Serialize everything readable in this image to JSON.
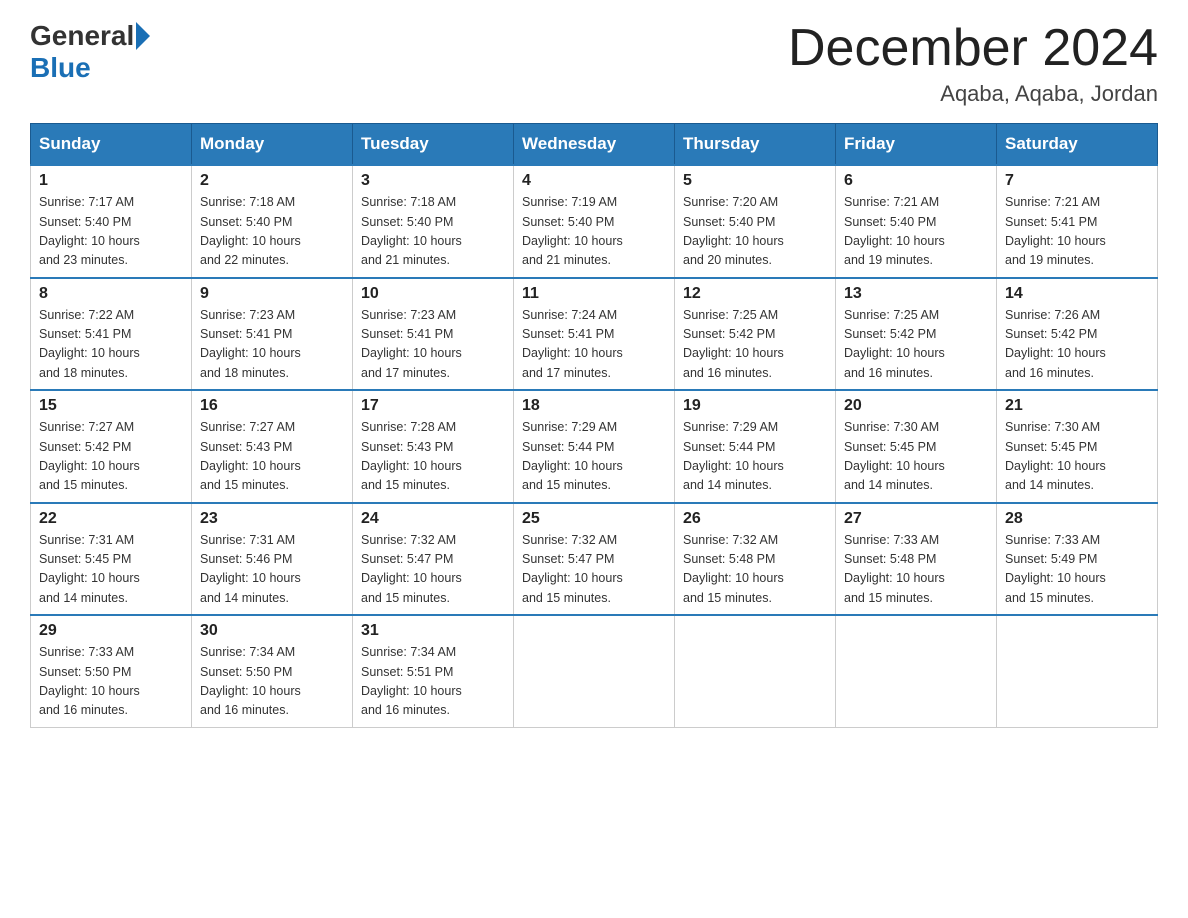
{
  "logo": {
    "general": "General",
    "blue": "Blue"
  },
  "title": "December 2024",
  "location": "Aqaba, Aqaba, Jordan",
  "days_of_week": [
    "Sunday",
    "Monday",
    "Tuesday",
    "Wednesday",
    "Thursday",
    "Friday",
    "Saturday"
  ],
  "weeks": [
    [
      {
        "day": "1",
        "sunrise": "7:17 AM",
        "sunset": "5:40 PM",
        "daylight": "10 hours and 23 minutes."
      },
      {
        "day": "2",
        "sunrise": "7:18 AM",
        "sunset": "5:40 PM",
        "daylight": "10 hours and 22 minutes."
      },
      {
        "day": "3",
        "sunrise": "7:18 AM",
        "sunset": "5:40 PM",
        "daylight": "10 hours and 21 minutes."
      },
      {
        "day": "4",
        "sunrise": "7:19 AM",
        "sunset": "5:40 PM",
        "daylight": "10 hours and 21 minutes."
      },
      {
        "day": "5",
        "sunrise": "7:20 AM",
        "sunset": "5:40 PM",
        "daylight": "10 hours and 20 minutes."
      },
      {
        "day": "6",
        "sunrise": "7:21 AM",
        "sunset": "5:40 PM",
        "daylight": "10 hours and 19 minutes."
      },
      {
        "day": "7",
        "sunrise": "7:21 AM",
        "sunset": "5:41 PM",
        "daylight": "10 hours and 19 minutes."
      }
    ],
    [
      {
        "day": "8",
        "sunrise": "7:22 AM",
        "sunset": "5:41 PM",
        "daylight": "10 hours and 18 minutes."
      },
      {
        "day": "9",
        "sunrise": "7:23 AM",
        "sunset": "5:41 PM",
        "daylight": "10 hours and 18 minutes."
      },
      {
        "day": "10",
        "sunrise": "7:23 AM",
        "sunset": "5:41 PM",
        "daylight": "10 hours and 17 minutes."
      },
      {
        "day": "11",
        "sunrise": "7:24 AM",
        "sunset": "5:41 PM",
        "daylight": "10 hours and 17 minutes."
      },
      {
        "day": "12",
        "sunrise": "7:25 AM",
        "sunset": "5:42 PM",
        "daylight": "10 hours and 16 minutes."
      },
      {
        "day": "13",
        "sunrise": "7:25 AM",
        "sunset": "5:42 PM",
        "daylight": "10 hours and 16 minutes."
      },
      {
        "day": "14",
        "sunrise": "7:26 AM",
        "sunset": "5:42 PM",
        "daylight": "10 hours and 16 minutes."
      }
    ],
    [
      {
        "day": "15",
        "sunrise": "7:27 AM",
        "sunset": "5:42 PM",
        "daylight": "10 hours and 15 minutes."
      },
      {
        "day": "16",
        "sunrise": "7:27 AM",
        "sunset": "5:43 PM",
        "daylight": "10 hours and 15 minutes."
      },
      {
        "day": "17",
        "sunrise": "7:28 AM",
        "sunset": "5:43 PM",
        "daylight": "10 hours and 15 minutes."
      },
      {
        "day": "18",
        "sunrise": "7:29 AM",
        "sunset": "5:44 PM",
        "daylight": "10 hours and 15 minutes."
      },
      {
        "day": "19",
        "sunrise": "7:29 AM",
        "sunset": "5:44 PM",
        "daylight": "10 hours and 14 minutes."
      },
      {
        "day": "20",
        "sunrise": "7:30 AM",
        "sunset": "5:45 PM",
        "daylight": "10 hours and 14 minutes."
      },
      {
        "day": "21",
        "sunrise": "7:30 AM",
        "sunset": "5:45 PM",
        "daylight": "10 hours and 14 minutes."
      }
    ],
    [
      {
        "day": "22",
        "sunrise": "7:31 AM",
        "sunset": "5:45 PM",
        "daylight": "10 hours and 14 minutes."
      },
      {
        "day": "23",
        "sunrise": "7:31 AM",
        "sunset": "5:46 PM",
        "daylight": "10 hours and 14 minutes."
      },
      {
        "day": "24",
        "sunrise": "7:32 AM",
        "sunset": "5:47 PM",
        "daylight": "10 hours and 15 minutes."
      },
      {
        "day": "25",
        "sunrise": "7:32 AM",
        "sunset": "5:47 PM",
        "daylight": "10 hours and 15 minutes."
      },
      {
        "day": "26",
        "sunrise": "7:32 AM",
        "sunset": "5:48 PM",
        "daylight": "10 hours and 15 minutes."
      },
      {
        "day": "27",
        "sunrise": "7:33 AM",
        "sunset": "5:48 PM",
        "daylight": "10 hours and 15 minutes."
      },
      {
        "day": "28",
        "sunrise": "7:33 AM",
        "sunset": "5:49 PM",
        "daylight": "10 hours and 15 minutes."
      }
    ],
    [
      {
        "day": "29",
        "sunrise": "7:33 AM",
        "sunset": "5:50 PM",
        "daylight": "10 hours and 16 minutes."
      },
      {
        "day": "30",
        "sunrise": "7:34 AM",
        "sunset": "5:50 PM",
        "daylight": "10 hours and 16 minutes."
      },
      {
        "day": "31",
        "sunrise": "7:34 AM",
        "sunset": "5:51 PM",
        "daylight": "10 hours and 16 minutes."
      },
      null,
      null,
      null,
      null
    ]
  ],
  "labels": {
    "sunrise_prefix": "Sunrise: ",
    "sunset_prefix": "Sunset: ",
    "daylight_prefix": "Daylight: "
  }
}
